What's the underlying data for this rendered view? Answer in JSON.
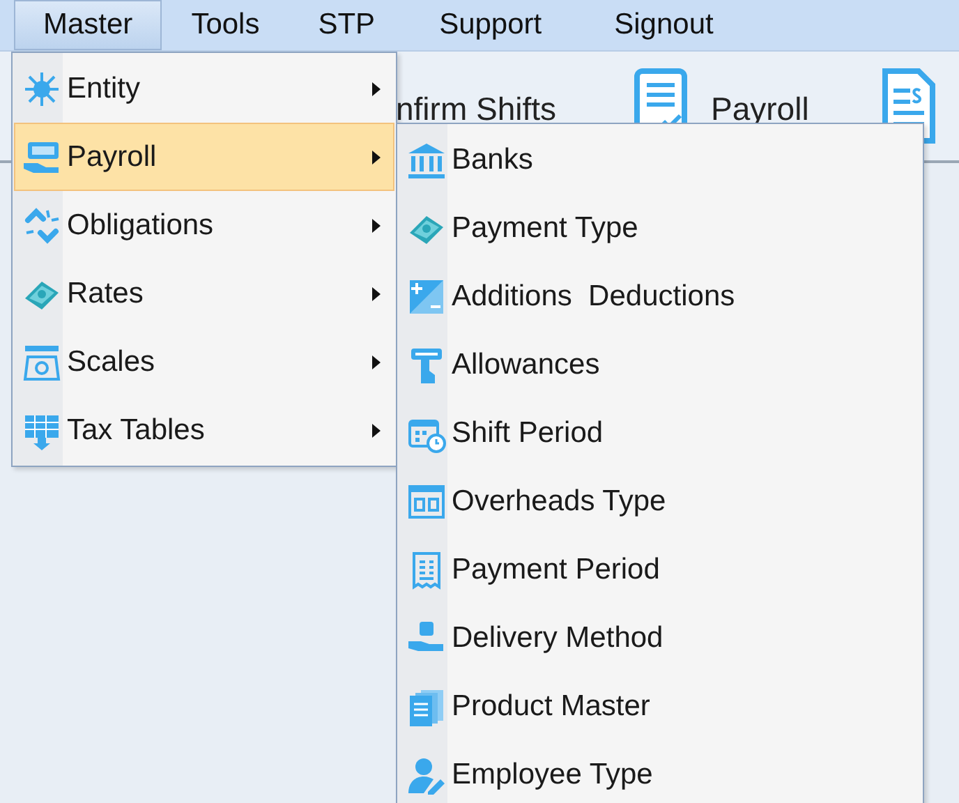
{
  "menubar": [
    {
      "label": "Master",
      "selected": true
    },
    {
      "label": "Tools",
      "selected": false
    },
    {
      "label": "STP",
      "selected": false
    },
    {
      "label": "Support",
      "selected": false
    },
    {
      "label": "Signout",
      "selected": false
    }
  ],
  "toolbar": [
    {
      "label": "nfirm Shifts"
    },
    {
      "label": "Payroll"
    }
  ],
  "menu": [
    {
      "label": "Entity",
      "selected": false,
      "has_submenu": true
    },
    {
      "label": "Payroll",
      "selected": true,
      "has_submenu": true
    },
    {
      "label": "Obligations",
      "selected": false,
      "has_submenu": true
    },
    {
      "label": "Rates",
      "selected": false,
      "has_submenu": true
    },
    {
      "label": "Scales",
      "selected": false,
      "has_submenu": true
    },
    {
      "label": "Tax Tables",
      "selected": false,
      "has_submenu": true
    }
  ],
  "submenu": [
    {
      "label": "Banks",
      "selected": false
    },
    {
      "label": "Payment Type",
      "selected": false
    },
    {
      "label": "Additions  Deductions",
      "selected": false
    },
    {
      "label": "Allowances",
      "selected": false
    },
    {
      "label": "Shift Period",
      "selected": false
    },
    {
      "label": "Overheads Type",
      "selected": false
    },
    {
      "label": "Payment Period",
      "selected": false
    },
    {
      "label": "Delivery Method",
      "selected": false
    },
    {
      "label": "Product Master",
      "selected": false
    },
    {
      "label": "Employee Type",
      "selected": false
    }
  ]
}
